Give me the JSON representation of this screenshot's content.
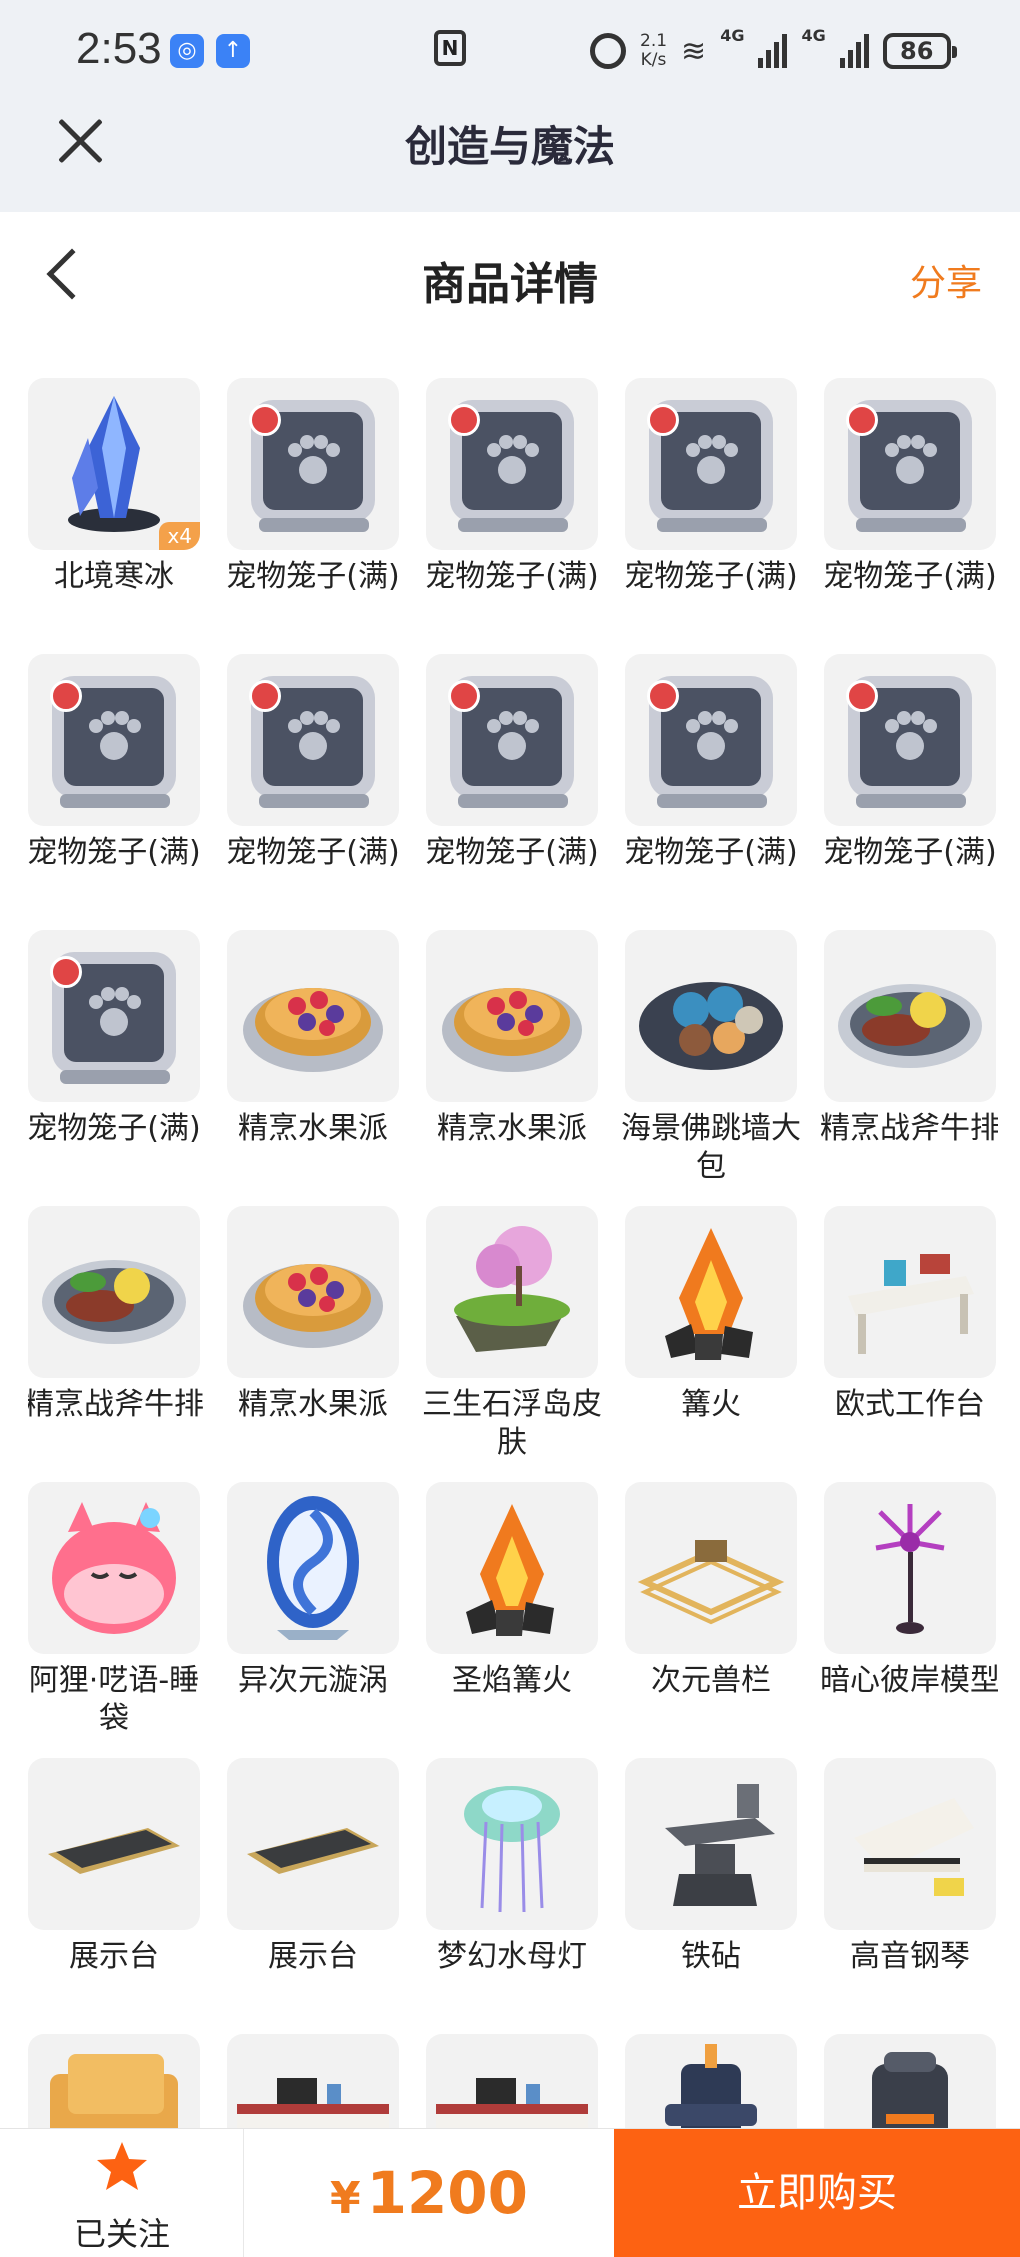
{
  "status": {
    "time": "2:53",
    "speed_top": "2.1",
    "speed_unit": "K/s",
    "net1": "4G",
    "net2": "4G",
    "battery": "86"
  },
  "app": {
    "title": "创造与魔法"
  },
  "page": {
    "title": "商品详情",
    "share_label": "分享"
  },
  "items": [
    {
      "name": "北境寒冰",
      "icon": "ice-crystal-icon",
      "qty": "x4"
    },
    {
      "name": "宠物笼子(满)",
      "icon": "pet-cage-icon"
    },
    {
      "name": "宠物笼子(满)",
      "icon": "pet-cage-icon"
    },
    {
      "name": "宠物笼子(满)",
      "icon": "pet-cage-icon"
    },
    {
      "name": "宠物笼子(满)",
      "icon": "pet-cage-icon"
    },
    {
      "name": "宠物笼子(满)",
      "icon": "pet-cage-icon"
    },
    {
      "name": "宠物笼子(满)",
      "icon": "pet-cage-icon"
    },
    {
      "name": "宠物笼子(满)",
      "icon": "pet-cage-icon"
    },
    {
      "name": "宠物笼子(满)",
      "icon": "pet-cage-icon"
    },
    {
      "name": "宠物笼子(满)",
      "icon": "pet-cage-icon"
    },
    {
      "name": "宠物笼子(满)",
      "icon": "pet-cage-icon"
    },
    {
      "name": "精烹水果派",
      "icon": "fruit-pie-icon"
    },
    {
      "name": "精烹水果派",
      "icon": "fruit-pie-icon"
    },
    {
      "name": "海景佛跳墙大包",
      "icon": "buns-plate-icon"
    },
    {
      "name": "精烹战斧牛排",
      "icon": "steak-plate-icon"
    },
    {
      "name": "精烹战斧牛排",
      "icon": "steak-plate-icon"
    },
    {
      "name": "精烹水果派",
      "icon": "fruit-pie-icon"
    },
    {
      "name": "三生石浮岛皮肤",
      "icon": "floating-island-icon"
    },
    {
      "name": "篝火",
      "icon": "campfire-icon"
    },
    {
      "name": "欧式工作台",
      "icon": "workbench-icon"
    },
    {
      "name": "阿狸·呓语-睡袋",
      "icon": "sleeping-bag-icon"
    },
    {
      "name": "异次元漩涡",
      "icon": "portal-icon"
    },
    {
      "name": "圣焰篝火",
      "icon": "campfire-icon"
    },
    {
      "name": "次元兽栏",
      "icon": "fence-icon"
    },
    {
      "name": "暗心彼岸模型",
      "icon": "flower-icon"
    },
    {
      "name": "展示台",
      "icon": "display-stand-icon"
    },
    {
      "name": "展示台",
      "icon": "display-stand-icon"
    },
    {
      "name": "梦幻水母灯",
      "icon": "jellyfish-lamp-icon"
    },
    {
      "name": "铁砧",
      "icon": "anvil-icon"
    },
    {
      "name": "高音钢琴",
      "icon": "piano-icon"
    },
    {
      "name": "",
      "icon": "armchair-icon"
    },
    {
      "name": "",
      "icon": "desk-icon"
    },
    {
      "name": "",
      "icon": "desk-icon"
    },
    {
      "name": "",
      "icon": "statue-icon"
    },
    {
      "name": "",
      "icon": "furnace-icon"
    }
  ],
  "bottom": {
    "follow_label": "已关注",
    "currency": "¥",
    "price": "1200",
    "buy_label": "立即购买"
  },
  "colors": {
    "accent": "#fd6212",
    "price": "#f07b1e",
    "share": "#f07b1e"
  }
}
